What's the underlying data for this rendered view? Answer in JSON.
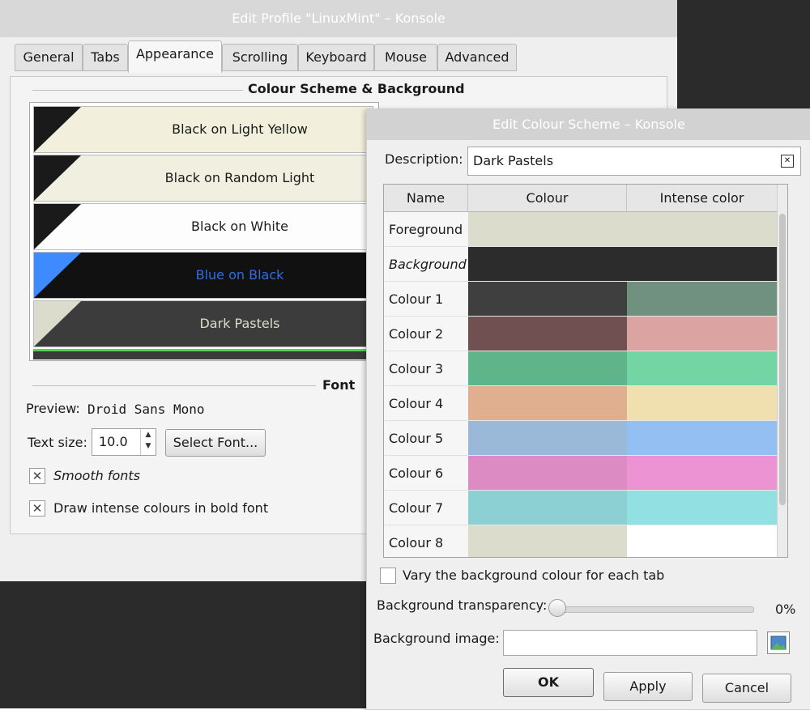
{
  "window1": {
    "title": "Edit Profile \"LinuxMint\" – Konsole",
    "tabs": [
      "General",
      "Tabs",
      "Appearance",
      "Scrolling",
      "Keyboard",
      "Mouse",
      "Advanced"
    ],
    "active_tab": "Appearance",
    "section_colour": "Colour Scheme & Background",
    "schemes": [
      {
        "label": "Black on Light Yellow",
        "bg": "#f2f0dc",
        "fg": "#1a1a1a",
        "corner": "#1a1a1a"
      },
      {
        "label": "Black on Random Light",
        "bg": "#f0efe0",
        "fg": "#1a1a1a",
        "corner": "#1a1a1a"
      },
      {
        "label": "Black on White",
        "bg": "#fdfdfd",
        "fg": "#1a1a1a",
        "corner": "#1a1a1a"
      },
      {
        "label": "Blue on Black",
        "bg": "#111111",
        "fg": "#2f6fe0",
        "corner": "#3d8bff"
      },
      {
        "label": "Dark Pastels",
        "bg": "#3c3c3c",
        "fg": "#dcdccc",
        "corner": "#dcdccc"
      }
    ],
    "section_font": "Font",
    "preview_label": "Preview:",
    "preview_value": "Droid Sans Mono",
    "text_size_label": "Text size:",
    "text_size_value": "10.0",
    "select_font_label": "Select Font...",
    "smooth_fonts_label": "Smooth fonts",
    "bold_intense_label": "Draw intense colours in bold font",
    "smooth_fonts_checked": true,
    "bold_intense_checked": true
  },
  "window2": {
    "title": "Edit Colour Scheme – Konsole",
    "description_label": "Description:",
    "description_value": "Dark Pastels",
    "columns": [
      "Name",
      "Colour",
      "Intense color"
    ],
    "rows": [
      {
        "name": "Foreground",
        "colour": "#dcdccc",
        "intense": "#dcdccc"
      },
      {
        "name": "Background",
        "colour": "#2c2c2c",
        "intense": "#2c2c2c"
      },
      {
        "name": "Colour 1",
        "colour": "#3f3f3f",
        "intense": "#709080"
      },
      {
        "name": "Colour 2",
        "colour": "#705050",
        "intense": "#dca3a3"
      },
      {
        "name": "Colour 3",
        "colour": "#60b48a",
        "intense": "#72d5a3"
      },
      {
        "name": "Colour 4",
        "colour": "#dfaf8f",
        "intense": "#f0dfaf"
      },
      {
        "name": "Colour 5",
        "colour": "#9ab8d7",
        "intense": "#94bff3"
      },
      {
        "name": "Colour 6",
        "colour": "#dc8cc3",
        "intense": "#ec93d3"
      },
      {
        "name": "Colour 7",
        "colour": "#8cd0d3",
        "intense": "#93e0e3"
      },
      {
        "name": "Colour 8",
        "colour": "#dcdccc",
        "intense": "#ffffff"
      }
    ],
    "vary_bg_label": "Vary the background colour for each tab",
    "vary_bg_checked": false,
    "transparency_label": "Background transparency:",
    "transparency_value": "0%",
    "bg_image_label": "Background image:",
    "bg_image_value": "",
    "ok_label": "OK",
    "apply_label": "Apply",
    "cancel_label": "Cancel"
  }
}
